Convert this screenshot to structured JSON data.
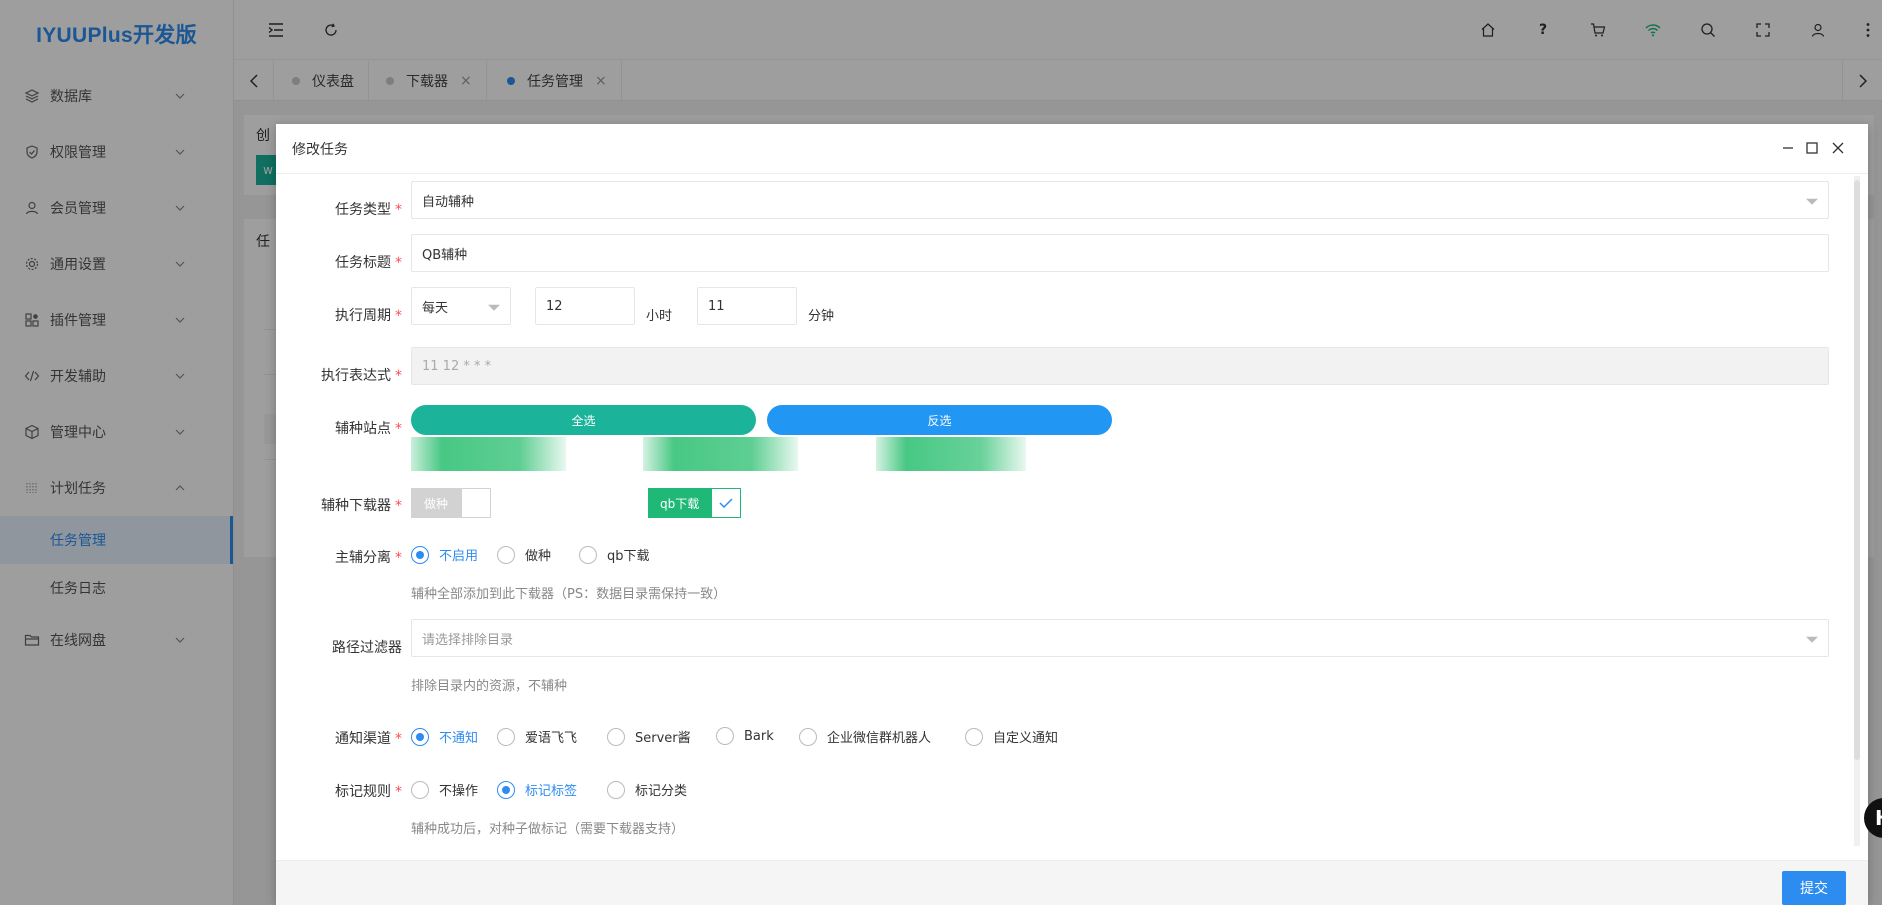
{
  "app": {
    "logo": "IYUUPlus开发版"
  },
  "sidebar": {
    "items": [
      {
        "label": "数据库",
        "icon": "database-icon"
      },
      {
        "label": "权限管理",
        "icon": "shield-icon"
      },
      {
        "label": "会员管理",
        "icon": "user-icon"
      },
      {
        "label": "通用设置",
        "icon": "gear-icon"
      },
      {
        "label": "插件管理",
        "icon": "plugin-icon"
      },
      {
        "label": "开发辅助",
        "icon": "code-icon"
      },
      {
        "label": "管理中心",
        "icon": "box-icon"
      },
      {
        "label": "计划任务",
        "icon": "list-icon"
      }
    ],
    "sub_items": [
      {
        "label": "任务管理",
        "active": true
      },
      {
        "label": "任务日志",
        "active": false
      }
    ],
    "last_item": {
      "label": "在线网盘",
      "icon": "folder-icon"
    }
  },
  "header": {
    "icons": [
      "menu-fold-icon",
      "refresh-icon",
      "home-icon",
      "help-icon",
      "cart-icon",
      "wifi-icon",
      "search-icon",
      "fullscreen-icon",
      "user-icon",
      "more-icon"
    ],
    "help_glyph": "?"
  },
  "tabs": [
    {
      "label": "仪表盘",
      "closable": false
    },
    {
      "label": "下载器",
      "closable": true
    },
    {
      "label": "任务管理",
      "closable": true,
      "active": true
    }
  ],
  "tab_close_glyph": "×",
  "background": {
    "label_1": "创",
    "label_2": "任",
    "btn": "w"
  },
  "modal": {
    "title": "修改任务",
    "task_type": {
      "label": "任务类型",
      "value": "自动辅种"
    },
    "task_title": {
      "label": "任务标题",
      "value": "QB辅种"
    },
    "cycle": {
      "label": "执行周期",
      "select": "每天",
      "hour": "12",
      "hour_unit": "小时",
      "minute": "11",
      "minute_unit": "分钟"
    },
    "cron": {
      "label": "执行表达式",
      "value": "11 12 * * *"
    },
    "sites": {
      "label": "辅种站点",
      "select_all": "全选",
      "invert": "反选"
    },
    "downloaders": {
      "label": "辅种下载器",
      "items": [
        {
          "name": "做种",
          "checked": false
        },
        {
          "name": "qb下载",
          "checked": true
        }
      ]
    },
    "split": {
      "label": "主辅分离",
      "options": [
        "不启用",
        "做种",
        "qb下载"
      ],
      "selected": "不启用",
      "hint": "辅种全部添加到此下载器（PS：数据目录需保持一致）"
    },
    "path_filter": {
      "label": "路径过滤器",
      "placeholder": "请选择排除目录",
      "hint": "排除目录内的资源，不辅种"
    },
    "notify": {
      "label": "通知渠道",
      "options": [
        "不通知",
        "爱语飞飞",
        "Server酱",
        "Bark",
        "企业微信群机器人",
        "自定义通知"
      ],
      "selected": "不通知"
    },
    "mark": {
      "label": "标记规则",
      "options": [
        "不操作",
        "标记标签",
        "标记分类"
      ],
      "selected": "标记标签",
      "hint": "辅种成功后，对种子做标记（需要下载器支持）"
    },
    "submit": "提交",
    "required_mark": "*"
  },
  "floating": {
    "glyph": "H"
  },
  "colors": {
    "primary": "#2d8cf0",
    "teal": "#1bb49b",
    "green": "#1fb877",
    "danger": "#ff4d4f"
  }
}
